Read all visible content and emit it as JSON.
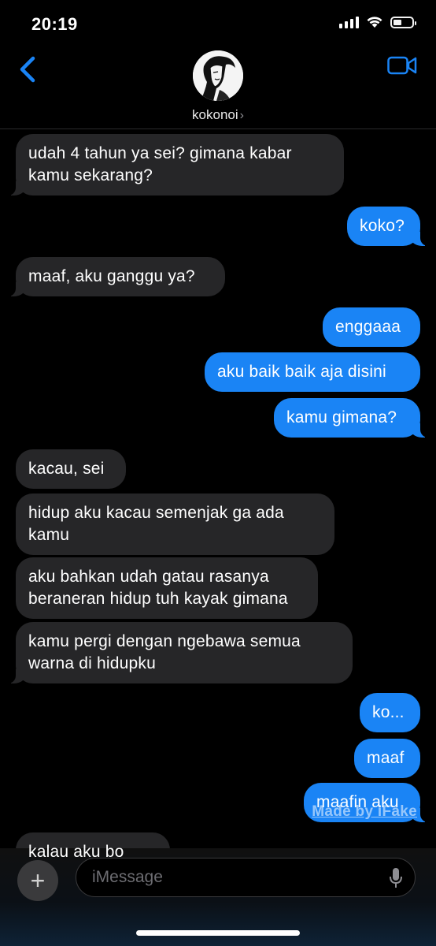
{
  "status_bar": {
    "time": "20:19"
  },
  "header": {
    "contact_name": "kokonoi",
    "chevron": "›"
  },
  "messages": [
    {
      "from": "them",
      "text": "udah 4 tahun ya sei? gimana kabar\nkamu sekarang?"
    },
    {
      "from": "me",
      "text": "koko?"
    },
    {
      "from": "them",
      "text": "maaf, aku ganggu ya?"
    },
    {
      "from": "me",
      "text": "enggaaa"
    },
    {
      "from": "me",
      "text": "aku baik baik aja disini"
    },
    {
      "from": "me",
      "text": "kamu gimana?"
    },
    {
      "from": "them",
      "text": "kacau, sei"
    },
    {
      "from": "them",
      "text": "hidup aku kacau semenjak ga ada\nkamu"
    },
    {
      "from": "them",
      "text": "aku bahkan udah gatau rasanya\nberaneran hidup tuh kayak gimana"
    },
    {
      "from": "them",
      "text": "kamu pergi dengan ngebawa semua\nwarna di hidupku"
    },
    {
      "from": "me",
      "text": "ko..."
    },
    {
      "from": "me",
      "text": "maaf"
    },
    {
      "from": "me",
      "text": "maafin aku"
    },
    {
      "from": "them",
      "text": "kalau aku bo"
    }
  ],
  "watermark": "Made by iFake",
  "composer": {
    "placeholder": "iMessage",
    "plus": "+"
  },
  "colors": {
    "outgoing": "#1a84f5",
    "incoming": "#262628",
    "accent": "#1a84f5"
  },
  "icons": {
    "back": "chevron-left-icon",
    "video": "video-camera-icon",
    "mic": "microphone-icon"
  }
}
